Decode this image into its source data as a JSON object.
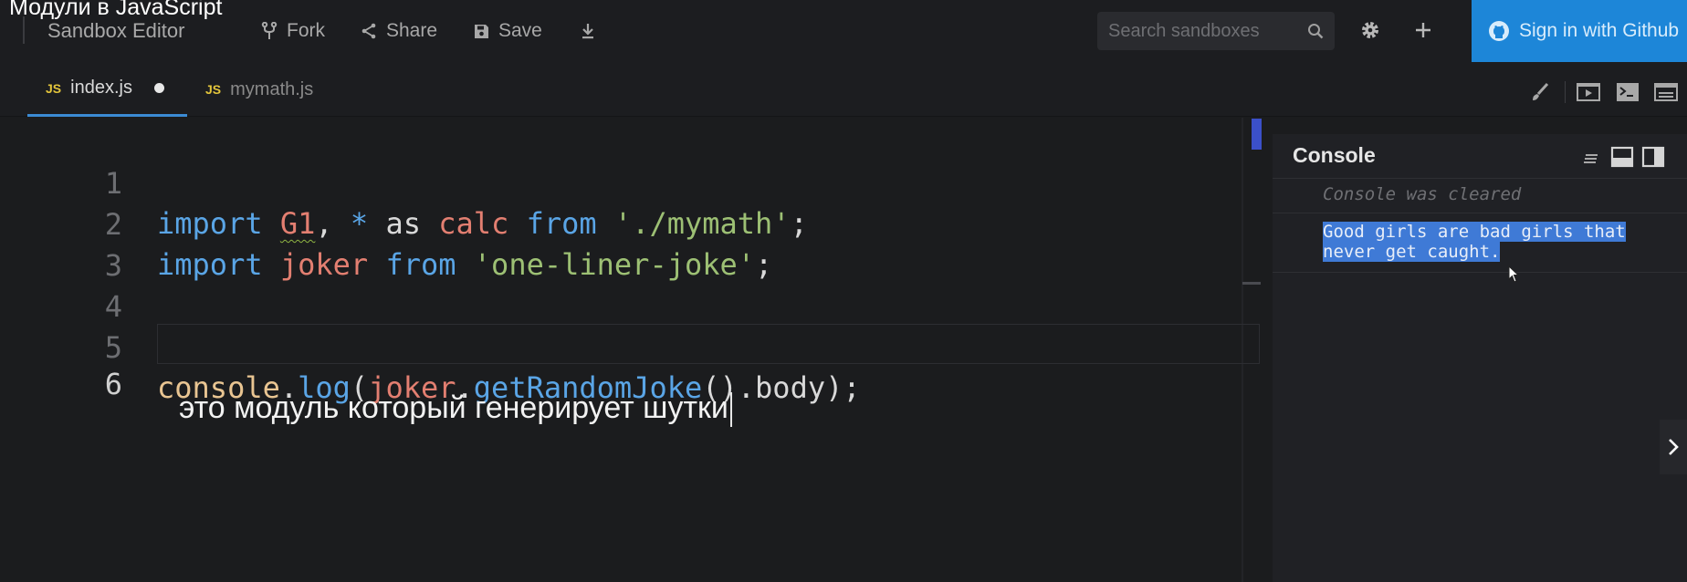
{
  "video_title": "Модули в JavaScript",
  "toolbar": {
    "app_title": "Sandbox Editor",
    "fork_label": "Fork",
    "share_label": "Share",
    "save_label": "Save",
    "search_placeholder": "Search sandboxes",
    "signin_label": "Sign in with Github"
  },
  "tabs": [
    {
      "badge": "JS",
      "label": "index.js",
      "active": true,
      "unsaved": true
    },
    {
      "badge": "JS",
      "label": "mymath.js",
      "active": false,
      "unsaved": false
    }
  ],
  "editor": {
    "line_numbers": [
      "1",
      "2",
      "3",
      "4",
      "5",
      "6"
    ],
    "current_line": 6,
    "lines": [
      "import G1, * as calc from './mymath';",
      "import joker from 'one-liner-joke';",
      "",
      "",
      "console.log(joker.getRandomJoke().body);",
      ""
    ],
    "tokens": {
      "import": "import",
      "g1": "G1",
      "comma": ",",
      "star": "*",
      "as": "as",
      "calc": "calc",
      "from": "from",
      "path1": "'./mymath'",
      "semi": ";",
      "joker": "joker",
      "path2": "'one-liner-joke'",
      "console": "console",
      "dot": ".",
      "log": "log",
      "lparen": "(",
      "get_random_joke": "getRandomJoke",
      "call_parens": "()",
      "body": "body",
      "rparen": ")"
    }
  },
  "subtitle": "это модуль который генерирует шутки",
  "console": {
    "title": "Console",
    "cleared_text": "Console was cleared",
    "message_line1": "Good girls are bad girls that",
    "message_line2": "never get caught."
  },
  "colors": {
    "accent": "#1d86d8",
    "keyword": "#5aa5e6",
    "identifier": "#e37f71",
    "string": "#9dc074",
    "selection": "#3f7ad6",
    "js_badge": "#e3c53b"
  },
  "icons": {
    "fork": "fork-icon",
    "share": "share-icon",
    "save": "save-icon",
    "download": "download-icon",
    "search": "search-icon",
    "settings": "gear-icon",
    "add": "plus-icon",
    "github": "github-icon"
  }
}
